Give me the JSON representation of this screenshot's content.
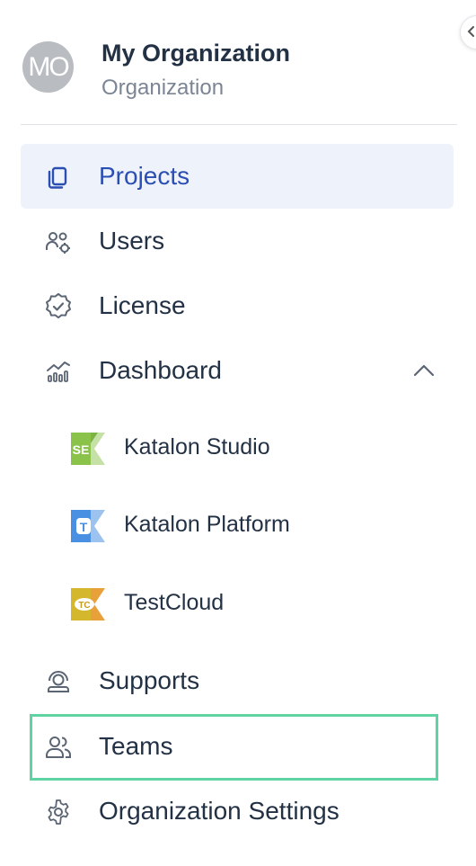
{
  "org": {
    "avatar_initials": "MO",
    "name": "My Organization",
    "type": "Organization"
  },
  "nav": {
    "projects": "Projects",
    "users": "Users",
    "license": "License",
    "dashboard": "Dashboard",
    "dashboard_sub": {
      "studio": "Katalon Studio",
      "platform": "Katalon Platform",
      "testcloud": "TestCloud"
    },
    "supports": "Supports",
    "teams": "Teams",
    "org_settings": "Organization Settings"
  },
  "logos": {
    "studio_text": "SE",
    "platform_text": "T",
    "testcloud_text": "TC"
  },
  "colors": {
    "active_bg": "#eef3fb",
    "active_text": "#2b4eb3",
    "highlight": "#5fd3a2"
  }
}
